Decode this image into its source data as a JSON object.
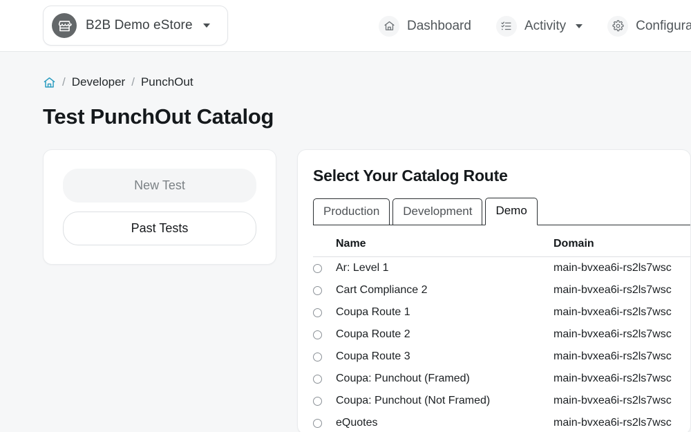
{
  "topbar": {
    "store_icon": "storefront-icon",
    "store_name": "B2B Demo eStore",
    "nav": [
      {
        "icon": "home-icon",
        "label": "Dashboard",
        "has_caret": false
      },
      {
        "icon": "checklist-icon",
        "label": "Activity",
        "has_caret": true
      },
      {
        "icon": "gear-icon",
        "label": "Configuration",
        "has_caret": false
      }
    ]
  },
  "breadcrumb": {
    "home_icon": "home-icon",
    "home_icon_color": "#2c9dc0",
    "separator": "/",
    "items": [
      "Developer",
      "PunchOut"
    ]
  },
  "page": {
    "title": "Test PunchOut Catalog"
  },
  "left_panel": {
    "new_test_label": "New Test",
    "past_tests_label": "Past Tests"
  },
  "right_panel": {
    "title": "Select Your Catalog Route",
    "tabs": [
      {
        "label": "Production",
        "active": false
      },
      {
        "label": "Development",
        "active": false
      },
      {
        "label": "Demo",
        "active": true
      }
    ],
    "table": {
      "headers": {
        "name": "Name",
        "domain": "Domain"
      },
      "rows": [
        {
          "name": "Ar: Level 1",
          "domain": "main-bvxea6i-rs2ls7wsc"
        },
        {
          "name": "Cart Compliance 2",
          "domain": "main-bvxea6i-rs2ls7wsc"
        },
        {
          "name": "Coupa Route 1",
          "domain": "main-bvxea6i-rs2ls7wsc"
        },
        {
          "name": "Coupa Route 2",
          "domain": "main-bvxea6i-rs2ls7wsc"
        },
        {
          "name": "Coupa Route 3",
          "domain": "main-bvxea6i-rs2ls7wsc"
        },
        {
          "name": "Coupa: Punchout (Framed)",
          "domain": "main-bvxea6i-rs2ls7wsc"
        },
        {
          "name": "Coupa: Punchout (Not Framed)",
          "domain": "main-bvxea6i-rs2ls7wsc"
        },
        {
          "name": "eQuotes",
          "domain": "main-bvxea6i-rs2ls7wsc"
        }
      ]
    }
  },
  "theme": {
    "page_background": "#f6f7f8",
    "card_background": "#ffffff",
    "accent": "#2c9dc0",
    "text_primary": "#15191c",
    "text_muted": "#7b8185"
  }
}
